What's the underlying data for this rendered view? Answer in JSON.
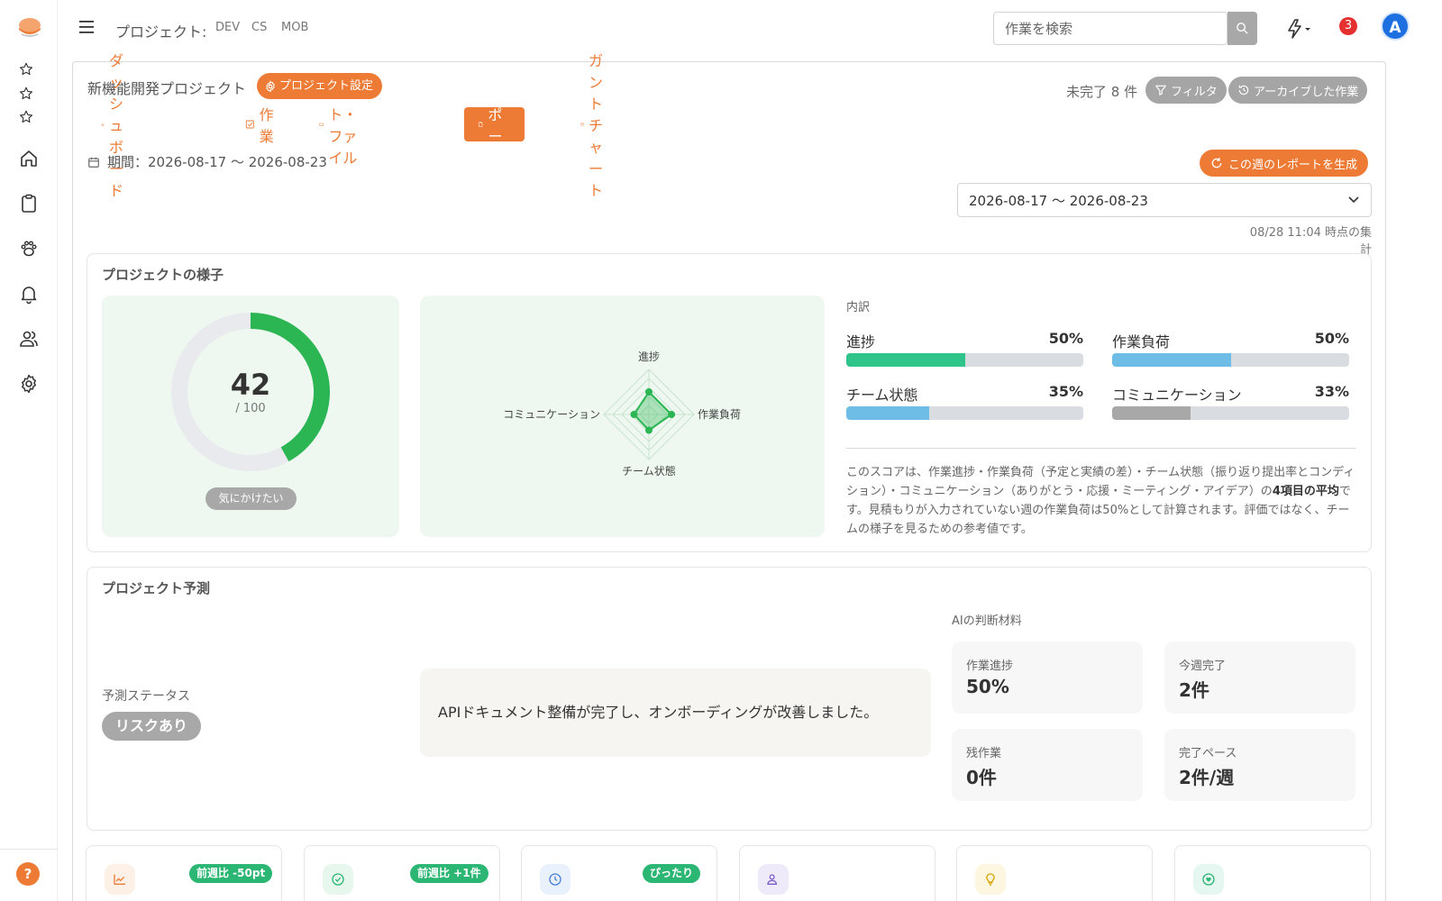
{
  "topbar": {
    "project_label": "プロジェクト:",
    "project_chips": [
      "DEV",
      "CS",
      "MOB"
    ],
    "search_placeholder": "作業を検索",
    "notification_count": "3",
    "avatar_initial": "A"
  },
  "header": {
    "project_title": "新機能開発プロジェクト",
    "settings_label": "プロジェクト設定",
    "incomplete_count": "未完了 8 件",
    "filter_label": "フィルタ",
    "archive_label": "アーカイブした作業"
  },
  "tabs": [
    {
      "label": "ダッシュボード",
      "icon": "bar-chart-icon"
    },
    {
      "label": "作業",
      "icon": "checkbox-icon"
    },
    {
      "label": "ノート・ファイル",
      "icon": "folder-icon"
    },
    {
      "label": "レポート",
      "icon": "document-icon"
    },
    {
      "label": "ガントチャート",
      "icon": "calendar-icon"
    }
  ],
  "report": {
    "period_text": "期間：2026-08-17 〜 2026-08-23",
    "generate_label": "この週のレポートを生成",
    "selected_period": "2026-08-17 〜 2026-08-23",
    "aggregate_time": "08/28 11:04 時点の集計"
  },
  "health": {
    "title": "プロジェクトの様子",
    "score": "42",
    "score_max": "/ 100",
    "score_value": 42,
    "score_max_value": 100,
    "status": "気にかけたい",
    "radar": {
      "axes": [
        "進捗",
        "作業負荷",
        "チーム状態",
        "コミュニケーション"
      ],
      "values": [
        50,
        50,
        35,
        33
      ]
    },
    "breakdown_title": "内訳",
    "metrics": [
      {
        "label": "進捗",
        "pct": "50%",
        "value": 50,
        "color": "#2ec48a"
      },
      {
        "label": "作業負荷",
        "pct": "50%",
        "value": 50,
        "color": "#6dbde6"
      },
      {
        "label": "チーム状態",
        "pct": "35%",
        "value": 35,
        "color": "#6dbde6"
      },
      {
        "label": "コミュニケーション",
        "pct": "33%",
        "value": 33,
        "color": "#a8a8a8"
      }
    ],
    "description_part1": "このスコアは、作業進捗・作業負荷（予定と実績の差）・チーム状態（振り返り提出率とコンディション）・コミュニケーション（ありがとう・応援・ミーティング・アイデア）の",
    "description_bold": "4項目の平均",
    "description_part2": "です。見積もりが入力されていない週の作業負荷は50%として計算されます。評価ではなく、チームの様子を見るための参考値です。"
  },
  "forecast": {
    "title": "プロジェクト予測",
    "status_label": "予測ステータス",
    "status": "リスクあり",
    "ai_comment": "APIドキュメント整備が完了し、オンボーディングが改善しました。",
    "ai_materials_title": "AIの判断材料",
    "materials": [
      {
        "label": "作業進捗",
        "value": "50%"
      },
      {
        "label": "今週完了",
        "value": "2件"
      },
      {
        "label": "残作業",
        "value": "0件"
      },
      {
        "label": "完了ペース",
        "value": "2件/週"
      }
    ]
  },
  "stat_cards": [
    {
      "badge": "前週比 -50pt",
      "icon": "trend-icon",
      "icon_bg": "#fdf0e6",
      "icon_color": "#ee7b35"
    },
    {
      "badge": "前週比 +1件",
      "icon": "check-circle-icon",
      "icon_bg": "#e8f7ee",
      "icon_color": "#2bb673"
    },
    {
      "badge": "ぴったり",
      "icon": "clock-icon",
      "icon_bg": "#e9f1fd",
      "icon_color": "#4a7fd6"
    },
    {
      "badge": "",
      "icon": "users-icon",
      "icon_bg": "#efeafa",
      "icon_color": "#7b5cc9"
    },
    {
      "badge": "",
      "icon": "lightbulb-icon",
      "icon_bg": "#fdf6e0",
      "icon_color": "#d9a300"
    },
    {
      "badge": "",
      "icon": "heart-chat-icon",
      "icon_bg": "#e6f7f1",
      "icon_color": "#2bb673"
    }
  ]
}
